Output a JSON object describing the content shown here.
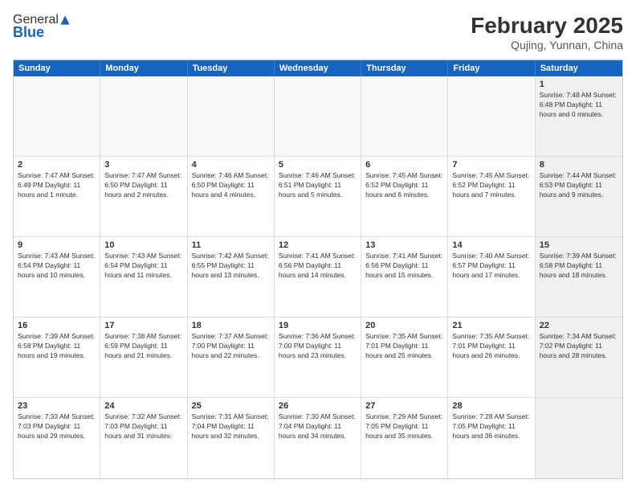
{
  "header": {
    "logo_general": "General",
    "logo_blue": "Blue",
    "month": "February 2025",
    "location": "Qujing, Yunnan, China"
  },
  "weekdays": [
    "Sunday",
    "Monday",
    "Tuesday",
    "Wednesday",
    "Thursday",
    "Friday",
    "Saturday"
  ],
  "weeks": [
    [
      {
        "day": "",
        "info": "",
        "empty": true
      },
      {
        "day": "",
        "info": "",
        "empty": true
      },
      {
        "day": "",
        "info": "",
        "empty": true
      },
      {
        "day": "",
        "info": "",
        "empty": true
      },
      {
        "day": "",
        "info": "",
        "empty": true
      },
      {
        "day": "",
        "info": "",
        "empty": true
      },
      {
        "day": "1",
        "info": "Sunrise: 7:48 AM\nSunset: 6:48 PM\nDaylight: 11 hours\nand 0 minutes.",
        "shaded": true
      }
    ],
    [
      {
        "day": "2",
        "info": "Sunrise: 7:47 AM\nSunset: 6:49 PM\nDaylight: 11 hours\nand 1 minute."
      },
      {
        "day": "3",
        "info": "Sunrise: 7:47 AM\nSunset: 6:50 PM\nDaylight: 11 hours\nand 2 minutes."
      },
      {
        "day": "4",
        "info": "Sunrise: 7:46 AM\nSunset: 6:50 PM\nDaylight: 11 hours\nand 4 minutes."
      },
      {
        "day": "5",
        "info": "Sunrise: 7:46 AM\nSunset: 6:51 PM\nDaylight: 11 hours\nand 5 minutes."
      },
      {
        "day": "6",
        "info": "Sunrise: 7:45 AM\nSunset: 6:52 PM\nDaylight: 11 hours\nand 6 minutes."
      },
      {
        "day": "7",
        "info": "Sunrise: 7:45 AM\nSunset: 6:52 PM\nDaylight: 11 hours\nand 7 minutes."
      },
      {
        "day": "8",
        "info": "Sunrise: 7:44 AM\nSunset: 6:53 PM\nDaylight: 11 hours\nand 9 minutes.",
        "shaded": true
      }
    ],
    [
      {
        "day": "9",
        "info": "Sunrise: 7:43 AM\nSunset: 6:54 PM\nDaylight: 11 hours\nand 10 minutes."
      },
      {
        "day": "10",
        "info": "Sunrise: 7:43 AM\nSunset: 6:54 PM\nDaylight: 11 hours\nand 11 minutes."
      },
      {
        "day": "11",
        "info": "Sunrise: 7:42 AM\nSunset: 6:55 PM\nDaylight: 11 hours\nand 13 minutes."
      },
      {
        "day": "12",
        "info": "Sunrise: 7:41 AM\nSunset: 6:56 PM\nDaylight: 11 hours\nand 14 minutes."
      },
      {
        "day": "13",
        "info": "Sunrise: 7:41 AM\nSunset: 6:56 PM\nDaylight: 11 hours\nand 15 minutes."
      },
      {
        "day": "14",
        "info": "Sunrise: 7:40 AM\nSunset: 6:57 PM\nDaylight: 11 hours\nand 17 minutes."
      },
      {
        "day": "15",
        "info": "Sunrise: 7:39 AM\nSunset: 6:58 PM\nDaylight: 11 hours\nand 18 minutes.",
        "shaded": true
      }
    ],
    [
      {
        "day": "16",
        "info": "Sunrise: 7:39 AM\nSunset: 6:58 PM\nDaylight: 11 hours\nand 19 minutes."
      },
      {
        "day": "17",
        "info": "Sunrise: 7:38 AM\nSunset: 6:59 PM\nDaylight: 11 hours\nand 21 minutes."
      },
      {
        "day": "18",
        "info": "Sunrise: 7:37 AM\nSunset: 7:00 PM\nDaylight: 11 hours\nand 22 minutes."
      },
      {
        "day": "19",
        "info": "Sunrise: 7:36 AM\nSunset: 7:00 PM\nDaylight: 11 hours\nand 23 minutes."
      },
      {
        "day": "20",
        "info": "Sunrise: 7:35 AM\nSunset: 7:01 PM\nDaylight: 11 hours\nand 25 minutes."
      },
      {
        "day": "21",
        "info": "Sunrise: 7:35 AM\nSunset: 7:01 PM\nDaylight: 11 hours\nand 26 minutes."
      },
      {
        "day": "22",
        "info": "Sunrise: 7:34 AM\nSunset: 7:02 PM\nDaylight: 11 hours\nand 28 minutes.",
        "shaded": true
      }
    ],
    [
      {
        "day": "23",
        "info": "Sunrise: 7:33 AM\nSunset: 7:03 PM\nDaylight: 11 hours\nand 29 minutes."
      },
      {
        "day": "24",
        "info": "Sunrise: 7:32 AM\nSunset: 7:03 PM\nDaylight: 11 hours\nand 31 minutes."
      },
      {
        "day": "25",
        "info": "Sunrise: 7:31 AM\nSunset: 7:04 PM\nDaylight: 11 hours\nand 32 minutes."
      },
      {
        "day": "26",
        "info": "Sunrise: 7:30 AM\nSunset: 7:04 PM\nDaylight: 11 hours\nand 34 minutes."
      },
      {
        "day": "27",
        "info": "Sunrise: 7:29 AM\nSunset: 7:05 PM\nDaylight: 11 hours\nand 35 minutes."
      },
      {
        "day": "28",
        "info": "Sunrise: 7:28 AM\nSunset: 7:05 PM\nDaylight: 11 hours\nand 36 minutes."
      },
      {
        "day": "",
        "info": "",
        "empty": true,
        "shaded": true
      }
    ]
  ]
}
